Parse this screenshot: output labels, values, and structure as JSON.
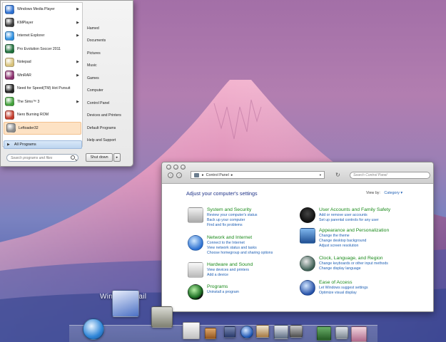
{
  "start_menu": {
    "programs": [
      {
        "label": "Windows Media Player",
        "icon": "windows-media-player-icon",
        "arrow": true,
        "color": "#2b6fd1"
      },
      {
        "label": "KMPlayer",
        "icon": "kmplayer-icon",
        "arrow": true,
        "color": "#3a3a3a"
      },
      {
        "label": "Internet Explorer",
        "icon": "internet-explorer-icon",
        "arrow": true,
        "color": "#2d8fe0"
      },
      {
        "label": "Pro Evolution Soccer 2011",
        "icon": "pes-2011-icon",
        "arrow": false,
        "color": "#1d6e3a"
      },
      {
        "label": "Notepad",
        "icon": "notepad-icon",
        "arrow": true,
        "color": "#d8c27a"
      },
      {
        "label": "WinRAR",
        "icon": "winrar-icon",
        "arrow": true,
        "color": "#8a2d6c"
      },
      {
        "label": "Need for Speed(TM) Hot Pursuit",
        "icon": "nfs-icon",
        "arrow": false,
        "color": "#222222"
      },
      {
        "label": "The Sims™ 3",
        "icon": "sims3-icon",
        "arrow": true,
        "color": "#41a03a"
      },
      {
        "label": "Nero Burning ROM",
        "icon": "nero-icon",
        "arrow": false,
        "color": "#c43a2a"
      },
      {
        "label": "Leftoader32",
        "icon": "leftoader-icon",
        "arrow": false,
        "color": "#8c8c8c"
      }
    ],
    "all_programs": "All Programs",
    "search_placeholder": "Search programs and files",
    "right_items": [
      "Hamed",
      "Documents",
      "Pictures",
      "Music",
      "Games",
      "Computer",
      "Control Panel",
      "Devices and Printers",
      "Default Programs",
      "Help and Support"
    ],
    "shutdown_label": "Shut down"
  },
  "control_panel": {
    "breadcrumb": "Control Panel",
    "search_placeholder": "Search Control Panel",
    "heading": "Adjust your computer's settings",
    "view_by_label": "View by:",
    "view_by_value": "Category ▾",
    "categories_left": [
      {
        "title": "System and Security",
        "icon": "system-security-icon",
        "links": [
          "Review your computer's status",
          "Back up your computer",
          "Find and fix problems"
        ]
      },
      {
        "title": "Network and Internet",
        "icon": "network-internet-icon",
        "links": [
          "Connect to the Internet",
          "View network status and tasks",
          "Choose homegroup and sharing options"
        ]
      },
      {
        "title": "Hardware and Sound",
        "icon": "hardware-sound-icon",
        "links": [
          "View devices and printers",
          "Add a device"
        ]
      },
      {
        "title": "Programs",
        "icon": "programs-icon",
        "links": [
          "Uninstall a program"
        ]
      }
    ],
    "categories_right": [
      {
        "title": "User Accounts and Family Safety",
        "icon": "user-accounts-icon",
        "links": [
          "Add or remove user accounts",
          "Set up parental controls for any user"
        ]
      },
      {
        "title": "Appearance and Personalization",
        "icon": "appearance-icon",
        "links": [
          "Change the theme",
          "Change desktop background",
          "Adjust screen resolution"
        ]
      },
      {
        "title": "Clock, Language, and Region",
        "icon": "clock-language-icon",
        "links": [
          "Change keyboards or other input methods",
          "Change display language"
        ]
      },
      {
        "title": "Ease of Access",
        "icon": "ease-of-access-icon",
        "links": [
          "Let Windows suggest settings",
          "Optimize visual display"
        ]
      }
    ]
  },
  "dock": {
    "hover_label": "Windows Mail",
    "items": [
      "safari-icon",
      "windows-mail-icon",
      "calculator-icon",
      "notepad-icon",
      "pencil-icon",
      "media-icon",
      "play-icon",
      "home-icon",
      "monitor-icon",
      "app-icon",
      "spreadsheet-icon",
      "trash-icon",
      "photos-icon"
    ]
  },
  "colors": {
    "link": "#1e5fb4",
    "category_title": "#1a8a1a",
    "heading": "#1e3287",
    "start_highlight": "#fde2c4"
  }
}
